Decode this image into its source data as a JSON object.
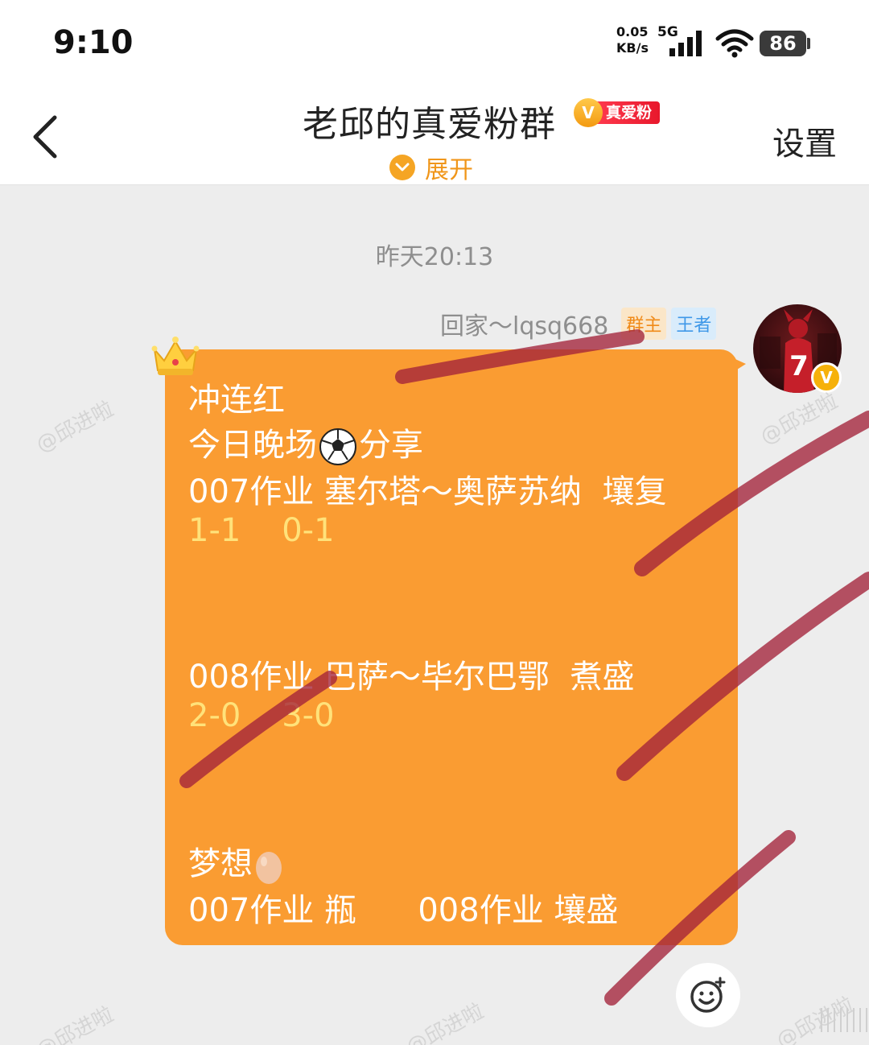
{
  "status_bar": {
    "time": "9:10",
    "net_speed_value": "0.05",
    "net_speed_unit": "KB/s",
    "network_type": "5G",
    "battery_level": "86"
  },
  "header": {
    "back_icon": "chevron-left-icon",
    "title": "老邱的真爱粉群",
    "fan_badge_letter": "V",
    "fan_badge_text": "真爱粉",
    "expand_label": "展开",
    "settings_label": "设置"
  },
  "chat": {
    "timestamp": "昨天20:13",
    "sender_name": "回家～lqsq668",
    "role_owner": "群主",
    "role_level": "王者",
    "avatar_badge": "V",
    "message": {
      "line1": "冲连红",
      "line2_a": "今日晚场",
      "line2_b": "分享",
      "line3": "007作业 塞尔塔～奥萨苏纳  壤复",
      "line4": "1-1    0-1",
      "line5": "008作业 巴萨～毕尔巴鄂  煮盛",
      "line6": "2-0    3-0",
      "line7": "梦想",
      "line8": "007作业 瓶      008作业 壤盛"
    }
  },
  "watermark_text": "@邱进啦",
  "colors": {
    "bubble": "#fa9c32",
    "accent": "#f5a524",
    "score": "#ffe27a",
    "scribble": "#a3233a"
  }
}
